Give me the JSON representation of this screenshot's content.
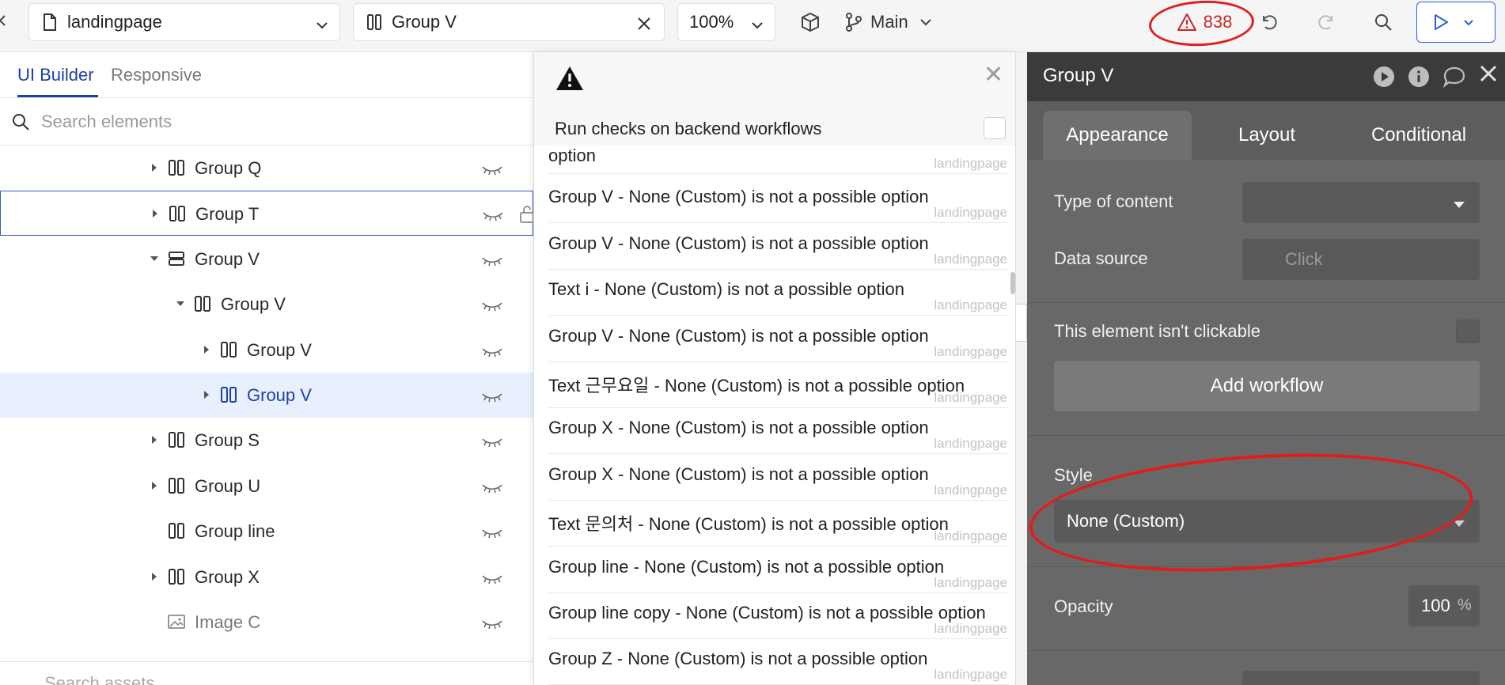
{
  "topbar": {
    "page_selector": "landingpage",
    "element_selector": "Group V",
    "zoom": "100%",
    "branch": "Main",
    "issues_count": "838"
  },
  "left_panel": {
    "tabs": [
      "UI Builder",
      "Responsive"
    ],
    "search_placeholder": "Search elements",
    "tree": [
      {
        "label": "Group Q",
        "type": "group-column",
        "indent": 0,
        "caret": "right",
        "state": "normal"
      },
      {
        "label": "Group T",
        "type": "group-column",
        "indent": 0,
        "caret": "right",
        "state": "hovered"
      },
      {
        "label": "Group V",
        "type": "group-row",
        "indent": 0,
        "caret": "down",
        "state": "normal"
      },
      {
        "label": "Group V",
        "type": "group-column",
        "indent": 1,
        "caret": "down",
        "state": "normal"
      },
      {
        "label": "Group V",
        "type": "group-column",
        "indent": 2,
        "caret": "right",
        "state": "normal"
      },
      {
        "label": "Group V",
        "type": "group-column",
        "indent": 2,
        "caret": "right",
        "state": "selected"
      },
      {
        "label": "Group S",
        "type": "group-column",
        "indent": 0,
        "caret": "right",
        "state": "normal"
      },
      {
        "label": "Group U",
        "type": "group-column",
        "indent": 0,
        "caret": "right",
        "state": "normal"
      },
      {
        "label": "Group line",
        "type": "group-column",
        "indent": 0,
        "caret": "none",
        "state": "normal"
      },
      {
        "label": "Group X",
        "type": "group-column",
        "indent": 0,
        "caret": "right",
        "state": "normal"
      },
      {
        "label": "Image C",
        "type": "image",
        "indent": 0,
        "caret": "none",
        "state": "muted"
      }
    ],
    "assets_placeholder": "Search assets"
  },
  "issues_panel": {
    "run_checks_label": "Run checks on backend workflows",
    "items": [
      {
        "message": "option",
        "page": "landingpage"
      },
      {
        "message": "Group V - None (Custom) is not a possible option",
        "page": "landingpage"
      },
      {
        "message": "Group V - None (Custom) is not a possible option",
        "page": "landingpage"
      },
      {
        "message": "Text i - None (Custom) is not a possible option",
        "page": "landingpage"
      },
      {
        "message": "Group V - None (Custom) is not a possible option",
        "page": "landingpage"
      },
      {
        "message": "Text 근무요일 - None (Custom) is not a possible option",
        "page": "landingpage"
      },
      {
        "message": "Group X - None (Custom) is not a possible option",
        "page": "landingpage"
      },
      {
        "message": "Group X - None (Custom) is not a possible option",
        "page": "landingpage"
      },
      {
        "message": "Text 문의처 - None (Custom) is not a possible option",
        "page": "landingpage"
      },
      {
        "message": "Group line - None (Custom) is not a possible option",
        "page": "landingpage"
      },
      {
        "message": "Group line copy - None (Custom) is not a possible option",
        "page": "landingpage"
      },
      {
        "message": "Group Z - None (Custom) is not a possible option",
        "page": "landingpage"
      }
    ]
  },
  "property_editor": {
    "title": "Group V",
    "tabs": [
      "Appearance",
      "Layout",
      "Conditional"
    ],
    "type_of_content_label": "Type of content",
    "type_of_content_value": "",
    "data_source_label": "Data source",
    "data_source_placeholder": "Click",
    "not_clickable_label": "This element isn't clickable",
    "add_workflow_label": "Add workflow",
    "style_label": "Style",
    "style_value": "None (Custom)",
    "opacity_label": "Opacity",
    "opacity_value": "100",
    "opacity_unit": "%"
  },
  "colors": {
    "accent": "#1d3faa",
    "issues": "#c62828",
    "annotation": "#e21c1c",
    "panel_dark": "#3b3b3b",
    "panel": "#686868"
  }
}
